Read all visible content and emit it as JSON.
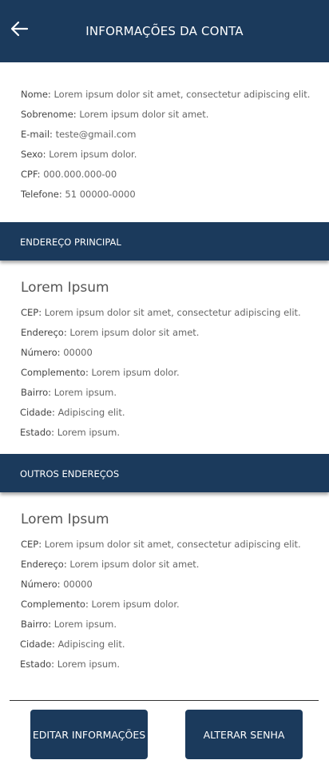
{
  "header": {
    "title": "INFORMAÇÕES DA CONTA"
  },
  "account": {
    "fields": [
      {
        "label": "Nome:",
        "value": "Lorem ipsum dolor sit amet, consectetur adipiscing elit."
      },
      {
        "label": "Sobrenome:",
        "value": "Lorem ipsum dolor sit amet."
      },
      {
        "label": "E-mail:",
        "value": "teste@gmail.com"
      },
      {
        "label": "Sexo:",
        "value": "Lorem ipsum dolor."
      },
      {
        "label": "CPF:",
        "value": "000.000.000-00"
      },
      {
        "label": "Telefone:",
        "value": "51 00000-0000"
      }
    ]
  },
  "main_address": {
    "section_title": "ENDEREÇO PRINCIPAL",
    "title": "Lorem Ipsum",
    "fields": [
      {
        "label": "CEP:",
        "value": "Lorem ipsum dolor sit amet, consectetur adipiscing elit."
      },
      {
        "label": "Endereço:",
        "value": "Lorem ipsum dolor sit amet."
      },
      {
        "label": "Número:",
        "value": "00000"
      },
      {
        "label": "Complemento:",
        "value": "Lorem ipsum dolor."
      },
      {
        "label": "Bairro:",
        "value": "Lorem ipsum."
      },
      {
        "label": "Cidade:",
        "value": "Adipiscing elit."
      },
      {
        "label": "Estado:",
        "value": "Lorem ipsum."
      }
    ]
  },
  "other_addresses": {
    "section_title": "OUTROS ENDEREÇOS",
    "title": "Lorem Ipsum",
    "fields": [
      {
        "label": "CEP:",
        "value": "Lorem ipsum dolor sit amet, consectetur adipiscing elit."
      },
      {
        "label": "Endereço:",
        "value": "Lorem ipsum dolor sit amet."
      },
      {
        "label": "Número:",
        "value": "00000"
      },
      {
        "label": "Complemento:",
        "value": "Lorem ipsum dolor."
      },
      {
        "label": "Bairro:",
        "value": "Lorem ipsum."
      },
      {
        "label": "Cidade:",
        "value": "Adipiscing elit."
      },
      {
        "label": "Estado:",
        "value": "Lorem ipsum."
      }
    ]
  },
  "actions": {
    "edit_label": "EDITAR INFORMAÇÕES",
    "password_label": "ALTERAR SENHA"
  }
}
